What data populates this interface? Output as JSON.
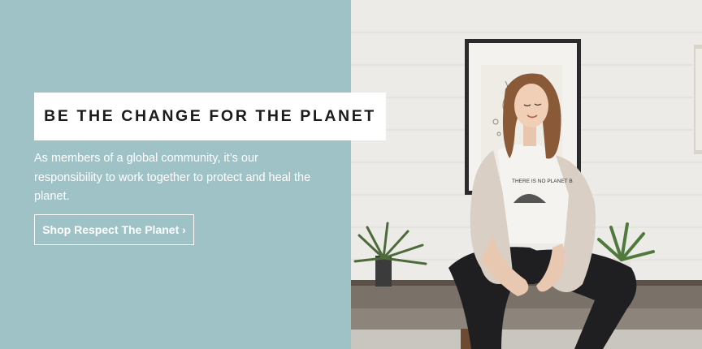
{
  "hero": {
    "headline": "BE THE CHANGE FOR THE PLANET",
    "body_text": "As members of a global community, it’s our responsibility to work together to protect and heal the planet.",
    "cta_label": "Shop Respect The Planet ›",
    "shirt_text": "THERE IS NO PLANET B"
  },
  "colors": {
    "panel_background": "#9fc2c7",
    "headline_box": "#ffffff",
    "headline_text": "#1b1b1b",
    "body_text": "#ffffff"
  },
  "photo": {
    "icon": "woman-sitting-on-bench-photo"
  }
}
